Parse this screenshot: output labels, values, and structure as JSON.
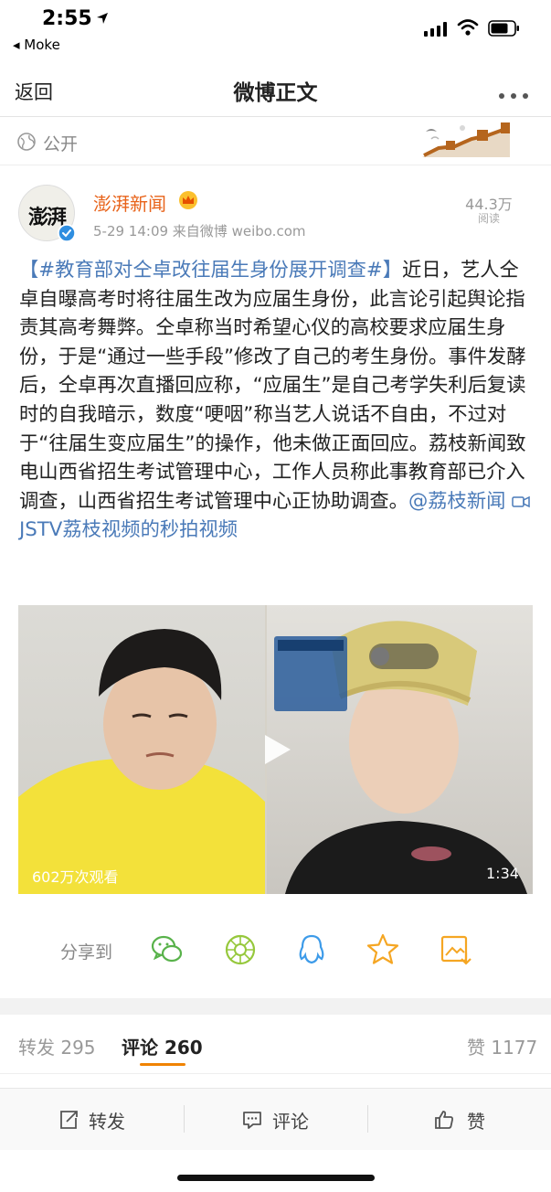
{
  "status_bar": {
    "time": "2:55",
    "back_app": "◂ Moke"
  },
  "nav": {
    "back": "返回",
    "title": "微博正文"
  },
  "visibility": {
    "label": "公开"
  },
  "author": {
    "avatar_text": "澎湃",
    "name": "澎湃新闻",
    "meta": "5-29 14:09  来自微博 weibo.com",
    "reads": "44.3万",
    "reads_label": "阅读"
  },
  "post": {
    "hashtag": "【#教育部对仝卓改往届生身份展开调查#】",
    "body": "近日，艺人仝卓自曝高考时将往届生改为应届生身份，此言论引起舆论指责其高考舞弊。仝卓称当时希望心仪的高校要求应届生身份，于是“通过一些手段”修改了自己的考生身份。事件发酵后，仝卓再次直播回应称，“应届生”是自己考学失利后复读时的自我暗示，数度“哽咽”称当艺人说话不自由，不过对于“往届生变应届生”的操作，他未做正面回应。荔枝新闻致电山西省招生考试管理中心，工作人员称此事教育部已介入调查，山西省招生考试管理中心正协助调查。",
    "mention": "@荔枝新闻",
    "video_link": "JSTV荔枝视频的秒拍视频"
  },
  "video": {
    "views": "602万次观看",
    "duration": "1:34"
  },
  "share": {
    "label": "分享到",
    "icons": [
      "wechat-icon",
      "moments-icon",
      "qq-icon",
      "favorite-icon",
      "save-image-icon"
    ]
  },
  "tabs": {
    "repost": "转发 295",
    "comment": "评论 260",
    "like": "赞 1177"
  },
  "bottom_bar": {
    "repost": "转发",
    "comment": "评论",
    "like": "赞"
  },
  "colors": {
    "accent_orange": "#f08300",
    "link_blue": "#4a7ab8",
    "author_orange": "#e8631a"
  }
}
